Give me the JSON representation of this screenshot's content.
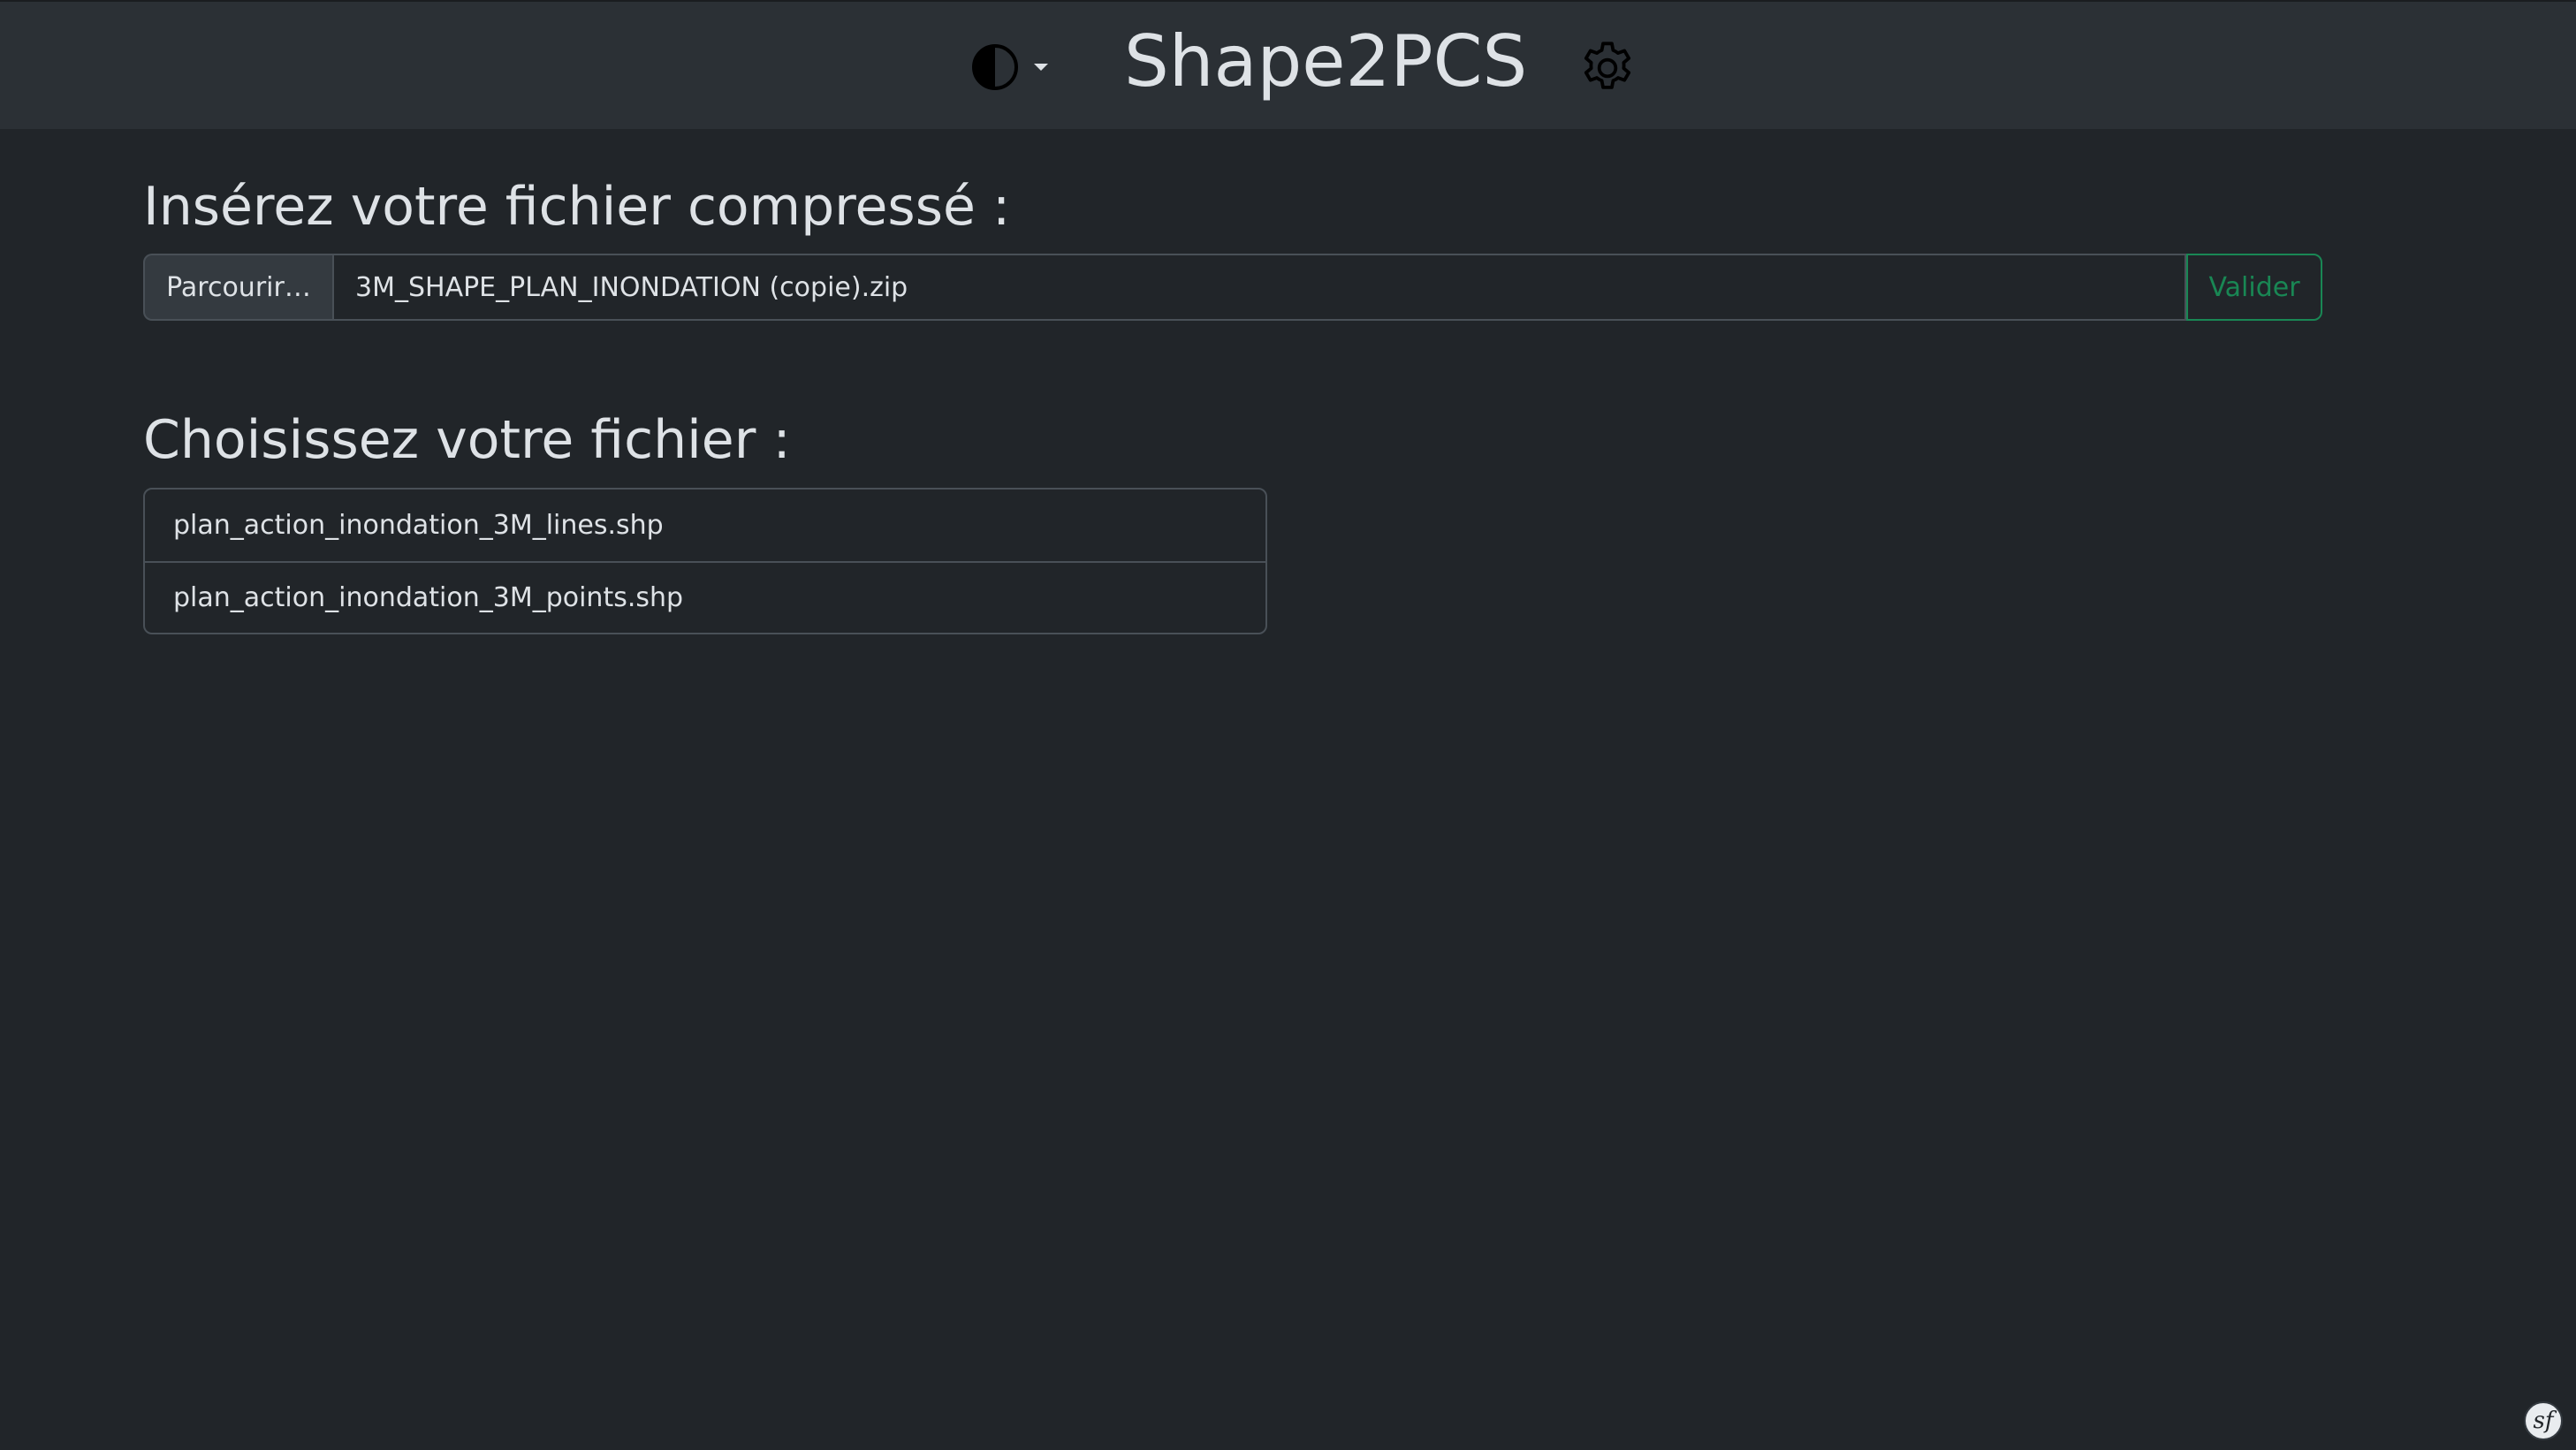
{
  "header": {
    "title": "Shape2PCS",
    "theme_icon": "half-circle-contrast-icon",
    "theme_caret_icon": "caret-down-icon",
    "settings_icon": "gear-icon"
  },
  "upload": {
    "heading": "Insérez votre fichier compressé :",
    "browse_label": "Parcourir…",
    "file_name": "3M_SHAPE_PLAN_INONDATION (copie).zip",
    "submit_label": "Valider"
  },
  "choose": {
    "heading": "Choisissez votre fichier :",
    "files": [
      "plan_action_inondation_3M_lines.shp",
      "plan_action_inondation_3M_points.shp"
    ]
  },
  "footer": {
    "badge_icon": "symfony-logo-icon",
    "badge_glyph": "sf"
  },
  "colors": {
    "background": "#212529",
    "header": "#2b3035",
    "border": "#495057",
    "accent_success": "#198754",
    "text": "#dee2e6"
  }
}
